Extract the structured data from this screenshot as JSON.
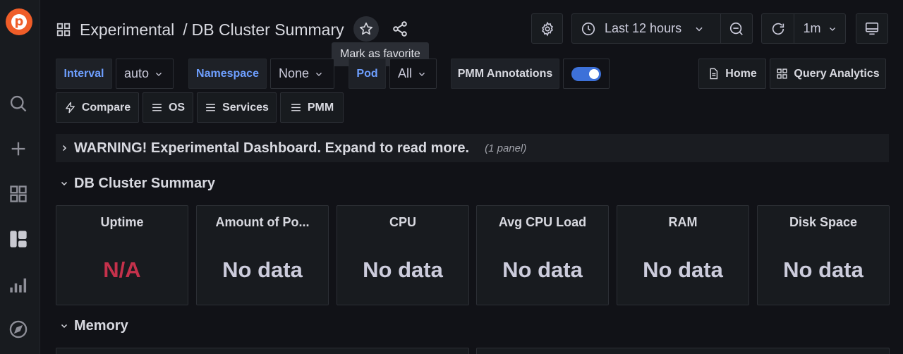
{
  "breadcrumb": {
    "folder": "Experimental",
    "separator": "/",
    "title": "DB Cluster Summary"
  },
  "tooltip": "Mark as favorite",
  "toolbar": {
    "time_range": "Last 12 hours",
    "refresh_interval": "1m"
  },
  "variables": [
    {
      "label": "Interval",
      "value": "auto"
    },
    {
      "label": "Namespace",
      "value": "None"
    },
    {
      "label": "Pod",
      "value": "All"
    }
  ],
  "annotations": {
    "label": "PMM Annotations",
    "enabled": true
  },
  "header_links": {
    "home": "Home",
    "query_analytics": "Query Analytics"
  },
  "dashboard_links": {
    "compare": "Compare",
    "os": "OS",
    "services": "Services",
    "pmm": "PMM"
  },
  "rows": {
    "warning": {
      "title": "WARNING! Experimental Dashboard. Expand to read more.",
      "count": "(1 panel)"
    },
    "summary": {
      "title": "DB Cluster Summary"
    },
    "memory": {
      "title": "Memory"
    }
  },
  "panels": [
    {
      "title": "Uptime",
      "value": "N/A"
    },
    {
      "title": "Amount of Po...",
      "value": "No data"
    },
    {
      "title": "CPU",
      "value": "No data"
    },
    {
      "title": "Avg CPU Load",
      "value": "No data"
    },
    {
      "title": "RAM",
      "value": "No data"
    },
    {
      "title": "Disk Space",
      "value": "No data"
    }
  ],
  "colors": {
    "accent": "#3d71d9",
    "brand": "#ef5d28",
    "na": "#c4314b",
    "variable_label": "#6e9fff"
  }
}
